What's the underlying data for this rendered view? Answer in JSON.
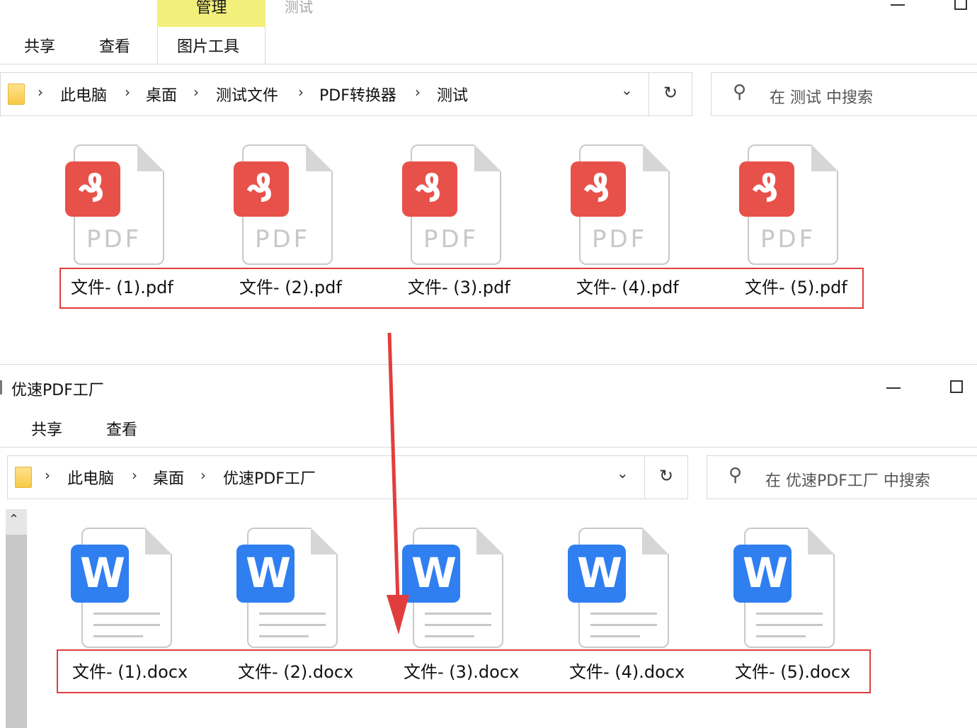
{
  "window1": {
    "title": "测试",
    "contextual_tab": "管理",
    "ribbon_tabs": [
      "共享",
      "查看",
      "图片工具"
    ],
    "breadcrumb": [
      "此电脑",
      "桌面",
      "测试文件",
      "PDF转换器",
      "测试"
    ],
    "search_placeholder": "在 测试 中搜索",
    "files": [
      "文件- (1).pdf",
      "文件- (2).pdf",
      "文件- (3).pdf",
      "文件- (4).pdf",
      "文件- (5).pdf"
    ],
    "file_type_label": "PDF"
  },
  "window2": {
    "title": "优速PDF工厂",
    "ribbon_tabs": [
      "共享",
      "查看"
    ],
    "breadcrumb": [
      "此电脑",
      "桌面",
      "优速PDF工厂"
    ],
    "search_placeholder": "在 优速PDF工厂 中搜索",
    "files": [
      "文件- (1).docx",
      "文件- (2).docx",
      "文件- (3).docx",
      "文件- (4).docx",
      "文件- (5).docx"
    ],
    "file_type_label": "W"
  },
  "icons": {
    "chevron": "›",
    "dropdown": "⌄",
    "refresh": "↻",
    "search": "⚲",
    "pdf_glyph": "₰",
    "scroll_up": "⌃"
  },
  "colors": {
    "manage_tab": "#f2f07a",
    "pdf_red": "#e8514a",
    "word_blue": "#2f7ff0",
    "highlight_red": "#e23d3d"
  }
}
